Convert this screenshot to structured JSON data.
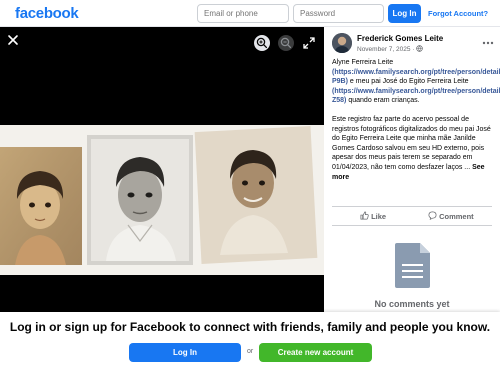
{
  "header": {
    "logo": "facebook",
    "email_placeholder": "Email or phone",
    "password_placeholder": "Password",
    "login_label": "Log In",
    "forgot_label": "Forgot Account?"
  },
  "viewer": {
    "icons": [
      "close-icon",
      "zoom-in-icon",
      "zoom-out-icon",
      "expand-icon"
    ],
    "background": "#000000"
  },
  "post": {
    "author": "Frederick Gomes Leite",
    "date": "November 7, 2025 · ",
    "audience_icon": "globe-icon",
    "p1_a": "Alyne Ferreira Leite ",
    "p1_link1": "(https://www.familysearch.org/pt/tree/person/details/PWQ2-P9B)",
    "p1_b": " e meu pai José do Egito Ferreira Leite ",
    "p1_link2": "(https://www.familysearch.org/pt/tree/person/details/PWQN-Z58)",
    "p1_c": " quando eram crianças.",
    "p2": "Este registro faz parte do acervo pessoal de registros fotográficos digitalizados do meu pai José do Egito Ferreira Leite que minha mãe Janilde Gomes Cardoso salvou em seu HD externo, pois apesar dos meus pais terem se separado em 01/04/2023, não tem como desfazer laços ... ",
    "see_more": "See more",
    "like_label": "Like",
    "comment_label": "Comment",
    "no_comments": "No comments yet"
  },
  "banner": {
    "text": "Log in or sign up for Facebook to connect with friends, family and people you know.",
    "login_label": "Log In",
    "or_label": "or",
    "create_label": "Create new account"
  },
  "colors": {
    "brand_blue": "#1877f2",
    "create_green": "#42b72a",
    "link_blue": "#385898"
  }
}
